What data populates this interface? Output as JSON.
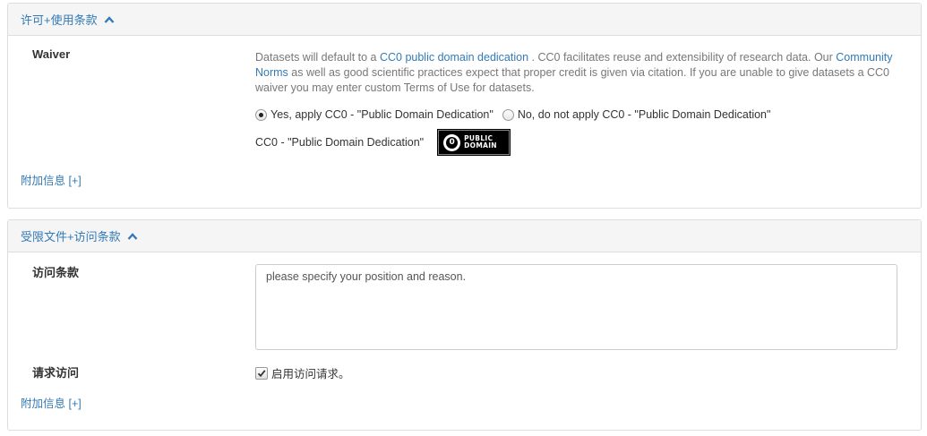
{
  "license_panel": {
    "title": "许可+使用条款",
    "waiver_label": "Waiver",
    "description": {
      "part1": "Datasets will default to a ",
      "link1": "CC0 public domain dedication",
      "part2": " . CC0 facilitates reuse and extensibility of research data. Our ",
      "link2": "Community Norms",
      "part3": " as well as good scientific practices expect that proper credit is given via citation. If you are unable to give datasets a CC0 waiver you may enter custom Terms of Use for datasets."
    },
    "option_yes": "Yes, apply CC0 - \"Public Domain Dedication\"",
    "option_no": "No, do not apply CC0 - \"Public Domain Dedication\"",
    "selected_option": "yes",
    "cc0_label": "CC0 - \"Public Domain Dedication\"",
    "badge": {
      "icon_glyph": "0",
      "line1": "PUBLIC",
      "line2": "DOMAIN"
    },
    "more_info": "附加信息 [+]"
  },
  "restricted_panel": {
    "title": "受限文件+访问条款",
    "access_terms_label": "访问条款",
    "access_terms_value": "please specify your position and reason.",
    "request_access_label": "请求访问",
    "request_access_checkbox": "启用访问请求。",
    "request_access_checked": true,
    "more_info": "附加信息 [+]"
  },
  "colors": {
    "link": "#337ab7",
    "heading_bg": "#f5f5f5",
    "border": "#dddddd",
    "muted_text": "#777777"
  },
  "icons": {
    "panel_toggle": "chevron-up-icon",
    "checkbox_mark": "check-icon"
  }
}
